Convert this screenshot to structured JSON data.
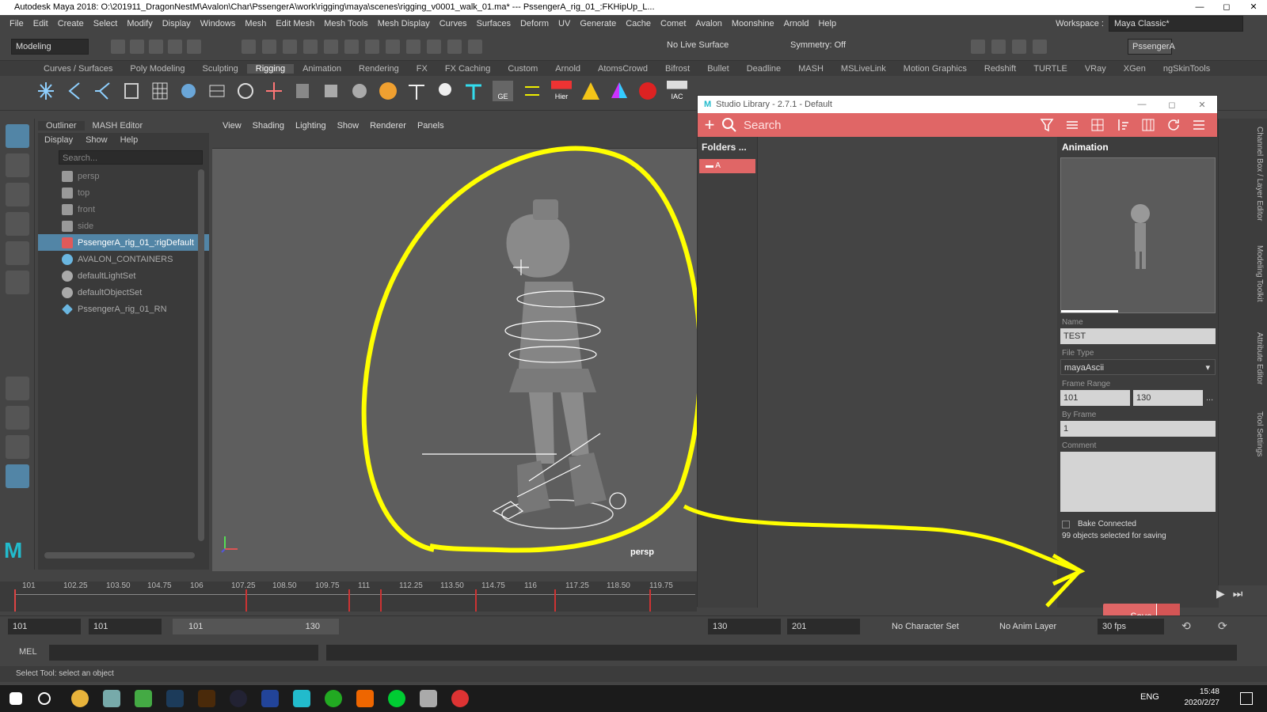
{
  "window": {
    "title": "Autodesk Maya 2018: O:\\201911_DragonNestM\\Avalon\\Char\\PssengerA\\work\\rigging\\maya\\scenes\\rigging_v0001_walk_01.ma*  ---  PssengerA_rig_01_:FKHipUp_L...",
    "min": "—",
    "max": "◻",
    "close": "✕"
  },
  "menu": [
    "File",
    "Edit",
    "Create",
    "Select",
    "Modify",
    "Display",
    "Windows",
    "Mesh",
    "Edit Mesh",
    "Mesh Tools",
    "Mesh Display",
    "Curves",
    "Surfaces",
    "Deform",
    "UV",
    "Generate",
    "Cache",
    "Comet",
    "Avalon",
    "Moonshine",
    "Arnold",
    "Help"
  ],
  "workspace": {
    "label": "Workspace :",
    "value": "Maya Classic*"
  },
  "status": {
    "mode": "Modeling",
    "live_surface": "No Live Surface",
    "symmetry": "Symmetry: Off",
    "user": "PssengerA"
  },
  "shelf_tabs": [
    "Curves / Surfaces",
    "Poly Modeling",
    "Sculpting",
    "Rigging",
    "Animation",
    "Rendering",
    "FX",
    "FX Caching",
    "Custom",
    "Arnold",
    "AtomsCrowd",
    "Bifrost",
    "Bullet",
    "Deadline",
    "MASH",
    "MSLiveLink",
    "Motion Graphics",
    "Redshift",
    "TURTLE",
    "VRay",
    "XGen",
    "ngSkinTools"
  ],
  "shelf_active": "Rigging",
  "shelf_labels": {
    "ge": "GE",
    "hier": "Hier",
    "iac": "IAC"
  },
  "outliner": {
    "tabs": [
      "Outliner",
      "MASH Editor"
    ],
    "menu": [
      "Display",
      "Show",
      "Help"
    ],
    "search_placeholder": "Search...",
    "rows": [
      {
        "label": "persp",
        "kind": "camera"
      },
      {
        "label": "top",
        "kind": "camera"
      },
      {
        "label": "front",
        "kind": "camera"
      },
      {
        "label": "side",
        "kind": "camera"
      },
      {
        "label": "PssengerA_rig_01_:rigDefault",
        "kind": "rig",
        "selected": true
      },
      {
        "label": "AVALON_CONTAINERS",
        "kind": "container"
      },
      {
        "label": "defaultLightSet",
        "kind": "set"
      },
      {
        "label": "defaultObjectSet",
        "kind": "set"
      },
      {
        "label": "PssengerA_rig_01_RN",
        "kind": "ref"
      }
    ]
  },
  "viewport": {
    "menu": [
      "View",
      "Shading",
      "Lighting",
      "Show",
      "Renderer",
      "Panels"
    ],
    "camera": "persp"
  },
  "studio_library": {
    "title": "Studio Library - 2.7.1 - Default",
    "search_placeholder": "Search",
    "folders_label": "Folders",
    "folders_more": "...",
    "folder": "A",
    "panel_title": "Animation",
    "name_label": "Name",
    "name_value": "TEST",
    "file_type_label": "File Type",
    "file_type_value": "mayaAscii",
    "frame_range_label": "Frame Range",
    "frame_start": "101",
    "frame_end": "130",
    "frame_more": "...",
    "by_frame_label": "By Frame",
    "by_frame_value": "1",
    "comment_label": "Comment",
    "bake_label": "Bake Connected",
    "selected_info": "99 objects selected for saving",
    "save_label": "Save",
    "accent": "#e06666"
  },
  "timeline_ticks": [
    "101",
    "102.25",
    "103.50",
    "104.75",
    "106",
    "107.25",
    "108.50",
    "109.75",
    "111",
    "112.25",
    "113.50",
    "114.75",
    "116",
    "117.25",
    "118.50",
    "119.75"
  ],
  "range": {
    "start": "101",
    "anim_start": "101",
    "slider_start": "101",
    "slider_end": "130",
    "end": "130",
    "anim_end": "201",
    "character_set": "No Character Set",
    "anim_layer": "No Anim Layer",
    "fps": "30 fps"
  },
  "command": {
    "lang": "MEL"
  },
  "help_text": "Select Tool: select an object",
  "tray": {
    "lang": "ENG",
    "time": "15:48",
    "date": "2020/2/27"
  },
  "right_tabs": [
    "Channel Box / Layer Editor",
    "Modeling Toolkit",
    "Attribute Editor",
    "Tool Settings"
  ],
  "annotation_color": "#ffff00"
}
